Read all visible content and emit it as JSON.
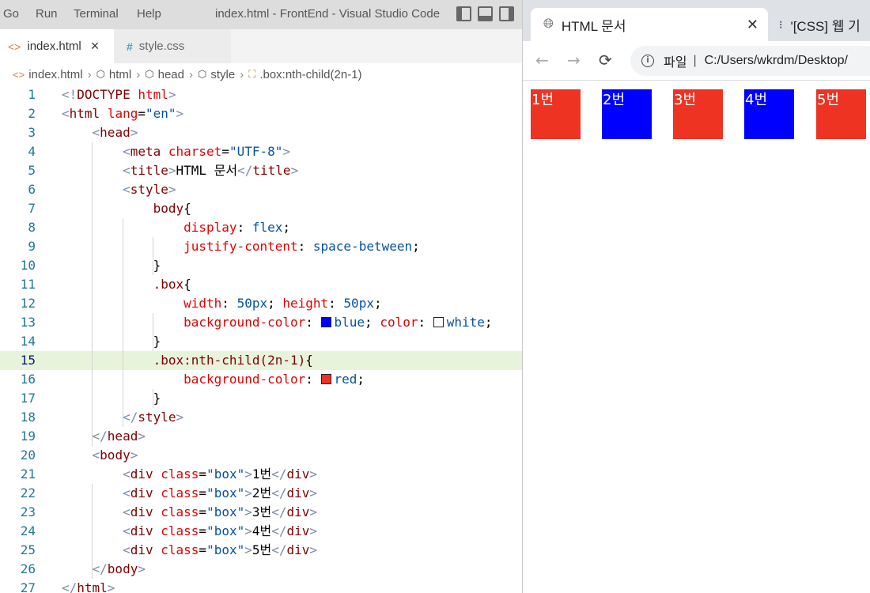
{
  "vscode": {
    "menu": [
      "Go",
      "Run",
      "Terminal",
      "Help"
    ],
    "window_title": "index.html - FrontEnd - Visual Studio Code",
    "tabs": [
      {
        "label": "index.html",
        "icon": "html-file-icon",
        "close": "×"
      },
      {
        "label": "style.css",
        "icon": "css-file-icon"
      }
    ],
    "breadcrumb": [
      "index.html",
      "html",
      "head",
      "style",
      ".box:nth-child(2n-1)"
    ],
    "current_line": 15,
    "lines": [
      {
        "n": "1",
        "tokens": [
          [
            "t-dim",
            "<!"
          ],
          [
            "t-tag",
            "DOCTYPE"
          ],
          [
            "t-txt",
            " "
          ],
          [
            "t-attr",
            "html"
          ],
          [
            "t-dim",
            ">"
          ]
        ]
      },
      {
        "n": "2",
        "tokens": [
          [
            "t-dim",
            "<"
          ],
          [
            "t-tag",
            "html"
          ],
          [
            "t-txt",
            " "
          ],
          [
            "t-attr",
            "lang"
          ],
          [
            "t-txt",
            "="
          ],
          [
            "t-str",
            "\"en\""
          ],
          [
            "t-dim",
            ">"
          ]
        ]
      },
      {
        "n": "3",
        "tokens": [
          [
            "t-txt",
            "    "
          ],
          [
            "t-dim",
            "<"
          ],
          [
            "t-tag",
            "head"
          ],
          [
            "t-dim",
            ">"
          ]
        ]
      },
      {
        "n": "4",
        "tokens": [
          [
            "t-txt",
            "        "
          ],
          [
            "t-dim",
            "<"
          ],
          [
            "t-tag",
            "meta"
          ],
          [
            "t-txt",
            " "
          ],
          [
            "t-attr",
            "charset"
          ],
          [
            "t-txt",
            "="
          ],
          [
            "t-str",
            "\"UTF-8\""
          ],
          [
            "t-dim",
            ">"
          ]
        ]
      },
      {
        "n": "5",
        "tokens": [
          [
            "t-txt",
            "        "
          ],
          [
            "t-dim",
            "<"
          ],
          [
            "t-tag",
            "title"
          ],
          [
            "t-dim",
            ">"
          ],
          [
            "t-txt",
            "HTML 문서"
          ],
          [
            "t-dim",
            "</"
          ],
          [
            "t-tag",
            "title"
          ],
          [
            "t-dim",
            ">"
          ]
        ]
      },
      {
        "n": "6",
        "tokens": [
          [
            "t-txt",
            "        "
          ],
          [
            "t-dim",
            "<"
          ],
          [
            "t-tag",
            "style"
          ],
          [
            "t-dim",
            ">"
          ]
        ]
      },
      {
        "n": "7",
        "tokens": [
          [
            "t-txt",
            "            "
          ],
          [
            "t-sel",
            "body"
          ],
          [
            "t-punc",
            "{"
          ]
        ]
      },
      {
        "n": "8",
        "tokens": [
          [
            "t-txt",
            "                "
          ],
          [
            "t-prop",
            "display"
          ],
          [
            "t-punc",
            ": "
          ],
          [
            "t-val",
            "flex"
          ],
          [
            "t-punc",
            ";"
          ]
        ]
      },
      {
        "n": "9",
        "tokens": [
          [
            "t-txt",
            "                "
          ],
          [
            "t-prop",
            "justify-content"
          ],
          [
            "t-punc",
            ": "
          ],
          [
            "t-val",
            "space-between"
          ],
          [
            "t-punc",
            ";"
          ]
        ]
      },
      {
        "n": "10",
        "tokens": [
          [
            "t-txt",
            "            "
          ],
          [
            "t-punc",
            "}"
          ]
        ]
      },
      {
        "n": "11",
        "tokens": [
          [
            "t-txt",
            "            "
          ],
          [
            "t-sel",
            ".box"
          ],
          [
            "t-punc",
            "{"
          ]
        ]
      },
      {
        "n": "12",
        "tokens": [
          [
            "t-txt",
            "                "
          ],
          [
            "t-prop",
            "width"
          ],
          [
            "t-punc",
            ": "
          ],
          [
            "t-val",
            "50px"
          ],
          [
            "t-punc",
            "; "
          ],
          [
            "t-prop",
            "height"
          ],
          [
            "t-punc",
            ": "
          ],
          [
            "t-val",
            "50px"
          ],
          [
            "t-punc",
            ";"
          ]
        ]
      },
      {
        "n": "13",
        "tokens": [
          [
            "t-txt",
            "                "
          ],
          [
            "t-prop",
            "background-color"
          ],
          [
            "t-punc",
            ": "
          ],
          [
            "swatch",
            "#0000ff"
          ],
          [
            "t-val",
            "blue"
          ],
          [
            "t-punc",
            "; "
          ],
          [
            "t-prop",
            "color"
          ],
          [
            "t-punc",
            ": "
          ],
          [
            "swatch",
            "#ffffff"
          ],
          [
            "t-val",
            "white"
          ],
          [
            "t-punc",
            ";"
          ]
        ]
      },
      {
        "n": "14",
        "tokens": [
          [
            "t-txt",
            "            "
          ],
          [
            "t-punc",
            "}"
          ]
        ]
      },
      {
        "n": "15",
        "tokens": [
          [
            "t-txt",
            "            "
          ],
          [
            "t-sel",
            ".box:nth-child(2n-1)"
          ],
          [
            "t-punc",
            "{"
          ]
        ]
      },
      {
        "n": "16",
        "tokens": [
          [
            "t-txt",
            "                "
          ],
          [
            "t-prop",
            "background-color"
          ],
          [
            "t-punc",
            ": "
          ],
          [
            "swatch",
            "#ee3322"
          ],
          [
            "t-val",
            "red"
          ],
          [
            "t-punc",
            ";"
          ]
        ]
      },
      {
        "n": "17",
        "tokens": [
          [
            "t-txt",
            "            "
          ],
          [
            "t-punc",
            "}"
          ]
        ]
      },
      {
        "n": "18",
        "tokens": [
          [
            "t-txt",
            "        "
          ],
          [
            "t-dim",
            "</"
          ],
          [
            "t-tag",
            "style"
          ],
          [
            "t-dim",
            ">"
          ]
        ]
      },
      {
        "n": "19",
        "tokens": [
          [
            "t-txt",
            "    "
          ],
          [
            "t-dim",
            "</"
          ],
          [
            "t-tag",
            "head"
          ],
          [
            "t-dim",
            ">"
          ]
        ]
      },
      {
        "n": "20",
        "tokens": [
          [
            "t-txt",
            "    "
          ],
          [
            "t-dim",
            "<"
          ],
          [
            "t-tag",
            "body"
          ],
          [
            "t-dim",
            ">"
          ]
        ]
      },
      {
        "n": "21",
        "tokens": [
          [
            "t-txt",
            "        "
          ],
          [
            "t-dim",
            "<"
          ],
          [
            "t-tag",
            "div"
          ],
          [
            "t-txt",
            " "
          ],
          [
            "t-attr",
            "class"
          ],
          [
            "t-txt",
            "="
          ],
          [
            "t-str",
            "\"box\""
          ],
          [
            "t-dim",
            ">"
          ],
          [
            "t-txt",
            "1번"
          ],
          [
            "t-dim",
            "</"
          ],
          [
            "t-tag",
            "div"
          ],
          [
            "t-dim",
            ">"
          ]
        ]
      },
      {
        "n": "22",
        "tokens": [
          [
            "t-txt",
            "        "
          ],
          [
            "t-dim",
            "<"
          ],
          [
            "t-tag",
            "div"
          ],
          [
            "t-txt",
            " "
          ],
          [
            "t-attr",
            "class"
          ],
          [
            "t-txt",
            "="
          ],
          [
            "t-str",
            "\"box\""
          ],
          [
            "t-dim",
            ">"
          ],
          [
            "t-txt",
            "2번"
          ],
          [
            "t-dim",
            "</"
          ],
          [
            "t-tag",
            "div"
          ],
          [
            "t-dim",
            ">"
          ]
        ]
      },
      {
        "n": "23",
        "tokens": [
          [
            "t-txt",
            "        "
          ],
          [
            "t-dim",
            "<"
          ],
          [
            "t-tag",
            "div"
          ],
          [
            "t-txt",
            " "
          ],
          [
            "t-attr",
            "class"
          ],
          [
            "t-txt",
            "="
          ],
          [
            "t-str",
            "\"box\""
          ],
          [
            "t-dim",
            ">"
          ],
          [
            "t-txt",
            "3번"
          ],
          [
            "t-dim",
            "</"
          ],
          [
            "t-tag",
            "div"
          ],
          [
            "t-dim",
            ">"
          ]
        ]
      },
      {
        "n": "24",
        "tokens": [
          [
            "t-txt",
            "        "
          ],
          [
            "t-dim",
            "<"
          ],
          [
            "t-tag",
            "div"
          ],
          [
            "t-txt",
            " "
          ],
          [
            "t-attr",
            "class"
          ],
          [
            "t-txt",
            "="
          ],
          [
            "t-str",
            "\"box\""
          ],
          [
            "t-dim",
            ">"
          ],
          [
            "t-txt",
            "4번"
          ],
          [
            "t-dim",
            "</"
          ],
          [
            "t-tag",
            "div"
          ],
          [
            "t-dim",
            ">"
          ]
        ]
      },
      {
        "n": "25",
        "tokens": [
          [
            "t-txt",
            "        "
          ],
          [
            "t-dim",
            "<"
          ],
          [
            "t-tag",
            "div"
          ],
          [
            "t-txt",
            " "
          ],
          [
            "t-attr",
            "class"
          ],
          [
            "t-txt",
            "="
          ],
          [
            "t-str",
            "\"box\""
          ],
          [
            "t-dim",
            ">"
          ],
          [
            "t-txt",
            "5번"
          ],
          [
            "t-dim",
            "</"
          ],
          [
            "t-tag",
            "div"
          ],
          [
            "t-dim",
            ">"
          ]
        ]
      },
      {
        "n": "26",
        "tokens": [
          [
            "t-txt",
            "    "
          ],
          [
            "t-dim",
            "</"
          ],
          [
            "t-tag",
            "body"
          ],
          [
            "t-dim",
            ">"
          ]
        ]
      },
      {
        "n": "27",
        "tokens": [
          [
            "t-dim",
            "</"
          ],
          [
            "t-tag",
            "html"
          ],
          [
            "t-dim",
            ">"
          ]
        ]
      }
    ]
  },
  "browser": {
    "tabs": [
      {
        "label": "HTML 문서",
        "icon": "globe-icon",
        "close": "✕"
      },
      {
        "label": "'[CSS] 웹 기",
        "icon": "site-favicon-icon"
      }
    ],
    "nav": {
      "back": "←",
      "forward": "→",
      "reload": "⟳"
    },
    "address": {
      "scheme_label": "파일",
      "separator": "|",
      "url": "C:/Users/wkrdm/Desktop/"
    },
    "boxes": [
      {
        "label": "1번",
        "color": "#ee3322"
      },
      {
        "label": "2번",
        "color": "#0000ff"
      },
      {
        "label": "3번",
        "color": "#ee3322"
      },
      {
        "label": "4번",
        "color": "#0000ff"
      },
      {
        "label": "5번",
        "color": "#ee3322"
      }
    ]
  }
}
